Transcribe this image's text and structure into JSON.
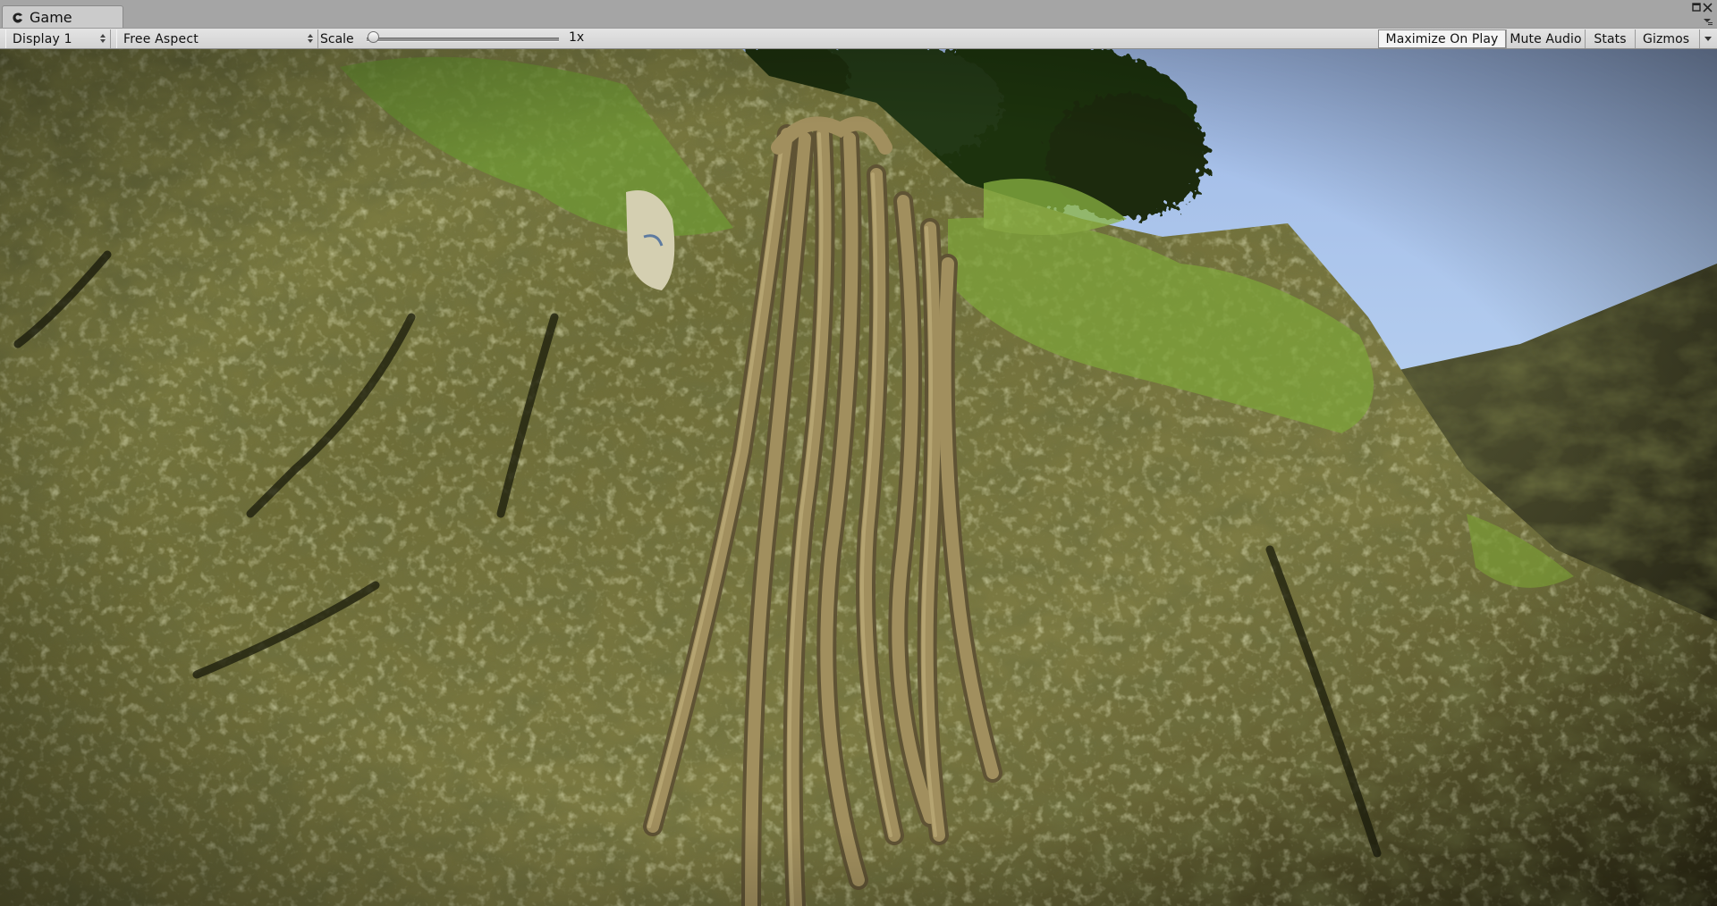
{
  "tab": {
    "label": "Game",
    "icon": "game-controller-icon"
  },
  "window_controls": {
    "maximize_icon": "maximize-icon",
    "close_icon": "close-icon",
    "menu_icon": "tab-menu-icon"
  },
  "toolbar": {
    "display_label": "Display 1",
    "aspect_label": "Free Aspect",
    "scale_label": "Scale",
    "scale_value": "1x",
    "scale_slider_fraction": 0.0,
    "maximize_on_play_label": "Maximize On Play",
    "maximize_on_play_active": true,
    "mute_audio_label": "Mute Audio",
    "stats_label": "Stats",
    "gizmos_label": "Gizmos"
  },
  "scene": {
    "description_icon": "game-render-view",
    "colors": {
      "sky_top": "#aec8ec",
      "sky_bottom": "#d2e6fa",
      "rock_dark": "#3e3f1f",
      "rock_mid": "#7b7a3f",
      "rock_light": "#b9bb72",
      "moss": "#7fa43a",
      "roots": "#9a8a5a",
      "tree": "#223312"
    }
  }
}
